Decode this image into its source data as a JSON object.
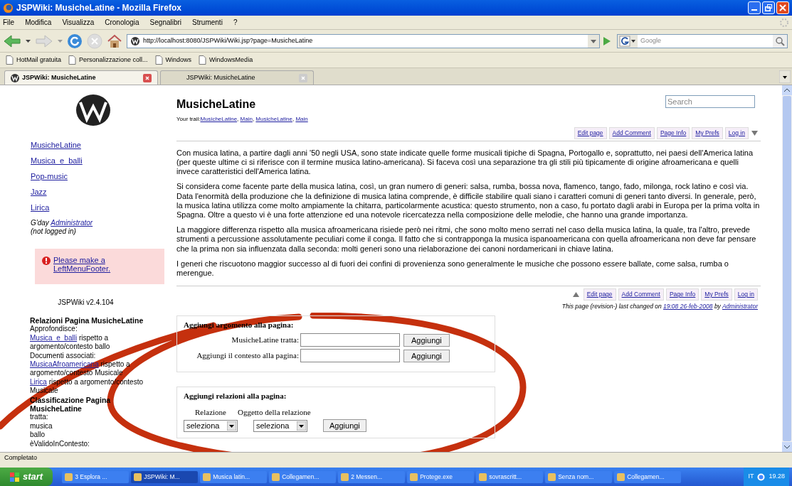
{
  "window": {
    "title": "JSPWiki: MusicheLatine - Mozilla Firefox"
  },
  "menu": [
    "File",
    "Modifica",
    "Visualizza",
    "Cronologia",
    "Segnalibri",
    "Strumenti",
    "?"
  ],
  "address": {
    "value": "http://localhost:8080/JSPWiki/Wiki.jsp?page=MusicheLatine"
  },
  "search_engine": {
    "placeholder": "Google"
  },
  "bookmarks": [
    "HotMail gratuita",
    "Personalizzazione coll...",
    "Windows",
    "WindowsMedia"
  ],
  "tabs": [
    {
      "label": "JSPWiki: MusicheLatine",
      "selected": true
    },
    {
      "label": "JSPWiki: MusicheLatine",
      "selected": false
    }
  ],
  "sidebar": {
    "links": [
      "MusicheLatine",
      "Musica_e_balli",
      "Pop-music",
      "Jazz",
      "Lirica"
    ],
    "greeting": {
      "text": "G'day",
      "user": "Administrator",
      "note": "(not logged in)"
    },
    "warning": {
      "text": "Please make a LeftMenuFooter."
    },
    "version": "JSPWiki v2.4.104",
    "relations": [
      {
        "kind": "heading",
        "text": "Relazioni Pagina MusicheLatine"
      },
      {
        "kind": "text",
        "text": "Approfondisce:"
      },
      {
        "kind": "link",
        "link": "Musica_e_balli",
        "text": "rispetto a argomento/contesto ballo"
      },
      {
        "kind": "text",
        "text": "Documenti associati:"
      },
      {
        "kind": "link",
        "link": "MusicaAfroamericana",
        "text": "rispetto a argomento/contesto Musicale"
      },
      {
        "kind": "link",
        "link": "Lirica",
        "text": "rispetto a argomento/contesto Musicale"
      },
      {
        "kind": "heading",
        "text": "Classificazione Pagina MusicheLatine"
      },
      {
        "kind": "text",
        "text": "tratta:"
      },
      {
        "kind": "text",
        "text": "musica"
      },
      {
        "kind": "text",
        "text": "ballo"
      },
      {
        "kind": "text",
        "text": "èValidoInContesto:"
      }
    ]
  },
  "page": {
    "title": "MusicheLatine",
    "search_placeholder": "Search",
    "trail_label": "Your trail:",
    "trail": [
      "MusicheLatine",
      "Main",
      "MusicheLatine",
      "Main"
    ],
    "trail_separator": ",",
    "actions_top": [
      "Edit page",
      "Add Comment",
      "Page Info",
      "My Prefs",
      "Log in"
    ],
    "paragraphs": [
      "Con musica latina, a partire dagli anni '50 negli USA, sono state indicate quelle forme musicali tipiche di Spagna, Portogallo e, soprattutto, nei paesi dell'America latina (per queste ultime ci si riferisce con il termine musica latino-americana). Si faceva così una separazione tra gli stili più tipicamente di origine afroamericana e quelli invece caratteristici dell'America latina.",
      "Si considera come facente parte della musica latina, così, un gran numero di generi: salsa, rumba, bossa nova, flamenco, tango, fado, milonga, rock latino e così via. Data l'enormità della produzione che la definizione di musica latina comprende, è difficile stabilire quali siano i caratteri comuni di generi tanto diversi. In generale, però, la musica latina utilizza come molto ampiamente la chitarra, particolarmente acustica: questo strumento, non a caso, fu portato dagli arabi in Europa per la prima volta in Spagna. Oltre a questo vi è una forte attenzione ed una notevole ricercatezza nella composizione delle melodie, che hanno una grande importanza.",
      "La maggiore differenza rispetto alla musica afroamericana risiede però nei ritmi, che sono molto meno serrati nel caso della musica latina, la quale, tra l'altro, prevede strumenti a percussione assolutamente peculiari come il conga. Il fatto che si contrapponga la musica ispanoamericana con quella afroamericana non deve far pensare che la prima non sia influenzata dalla seconda: molti generi sono una rielaborazione dei canoni nordamericani in chiave latina.",
      "I generi che riscuotono maggior successo al di fuori dei confini di provenienza sono generalmente le musiche che possono essere ballate, come salsa, rumba o merengue."
    ],
    "actions_bottom": [
      "Edit page",
      "Add Comment",
      "Page Info",
      "My Prefs",
      "Log in"
    ],
    "changed": {
      "prefix": "This page (revision-) last changed on",
      "date": "19:08 26-feb-2008",
      "by": "by",
      "user": "Administrator"
    },
    "topic_form": {
      "title": "Aggiungi argomento alla pagina:",
      "fields": [
        {
          "label": "MusicheLatine tratta:",
          "button": "Aggiungi"
        },
        {
          "label": "Aggiungi il contesto alla pagina:",
          "button": "Aggiungi"
        }
      ]
    },
    "relation_form": {
      "title": "Aggiungi relazioni alla pagina:",
      "columns": [
        "Relazione",
        "Oggetto della relazione"
      ],
      "selects": [
        "seleziona",
        "seleziona"
      ],
      "button": "Aggiungi"
    }
  },
  "status_bar": "Completato",
  "taskbar": {
    "start": "start",
    "items": [
      {
        "label": "3 Esplora ...",
        "selected": false
      },
      {
        "label": "JSPWiki: M...",
        "selected": true
      },
      {
        "label": "Musica latin...",
        "selected": false
      },
      {
        "label": "Collegamen...",
        "selected": false
      },
      {
        "label": "2 Messen...",
        "selected": false
      },
      {
        "label": "Protege.exe",
        "selected": false
      },
      {
        "label": "sovrascritt...",
        "selected": false
      },
      {
        "label": "Senza nom...",
        "selected": false
      },
      {
        "label": "Collegamen...",
        "selected": false
      }
    ],
    "language": "IT",
    "clock": "19.28"
  }
}
